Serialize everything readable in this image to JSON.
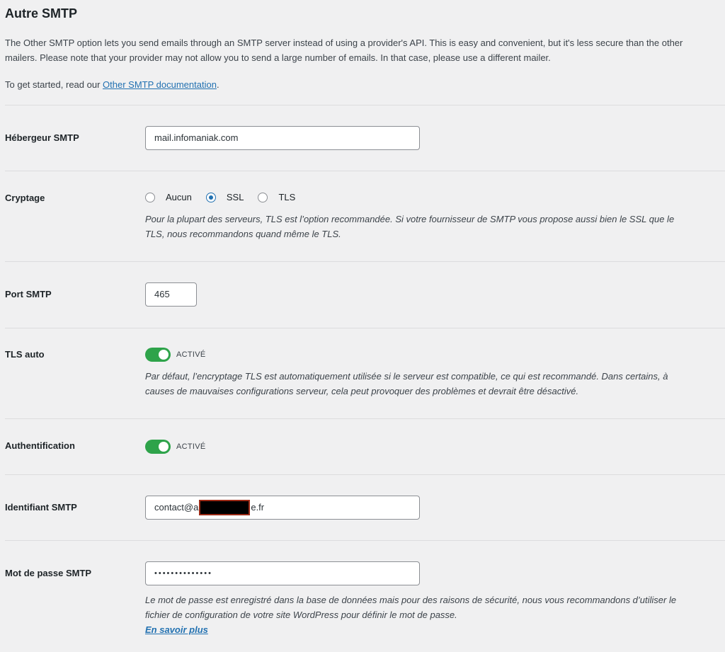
{
  "section": {
    "title": "Autre SMTP",
    "intro_paragraph": "The Other SMTP option lets you send emails through an SMTP server instead of using a provider's API. This is easy and convenient, but it's less secure than the other mailers. Please note that your provider may not allow you to send a large number of emails. In that case, please use a different mailer.",
    "get_started_prefix": "To get started, read our ",
    "doc_link_label": "Other SMTP documentation",
    "get_started_suffix": "."
  },
  "host": {
    "label": "Hébergeur SMTP",
    "value": "mail.infomaniak.com"
  },
  "encryption": {
    "label": "Cryptage",
    "options": [
      "Aucun",
      "SSL",
      "TLS"
    ],
    "selected": "SSL",
    "description": "Pour la plupart des serveurs, TLS est l’option recommandée. Si votre fournisseur de SMTP vous propose aussi bien le SSL que le TLS, nous recommandons quand même le TLS."
  },
  "port": {
    "label": "Port SMTP",
    "value": "465"
  },
  "auto_tls": {
    "label": "TLS auto",
    "enabled": true,
    "state_label": "ACTIVÉ",
    "description": "Par défaut, l’encryptage TLS est automatiquement utilisée si le serveur est compatible, ce qui est recommandé. Dans certains, à causes de mauvaises configurations serveur, cela peut provoquer des problèmes et devrait être désactivé."
  },
  "authentication": {
    "label": "Authentification",
    "enabled": true,
    "state_label": "ACTIVÉ"
  },
  "username": {
    "label": "Identifiant SMTP",
    "value_prefix": "contact@a",
    "value_suffix": "e.fr"
  },
  "password": {
    "label": "Mot de passe SMTP",
    "masked_value": "••••••••••••••",
    "description": "Le mot de passe est enregistré dans la base de données mais pour des raisons de sécurité, nous vous recommandons d’utiliser le fichier de configuration de votre site WordPress pour définir le mot de passe.",
    "learn_more_label": "En savoir plus"
  },
  "colors": {
    "link": "#2271b1",
    "toggle_on": "#2ea34a",
    "background": "#f0f0f1"
  }
}
